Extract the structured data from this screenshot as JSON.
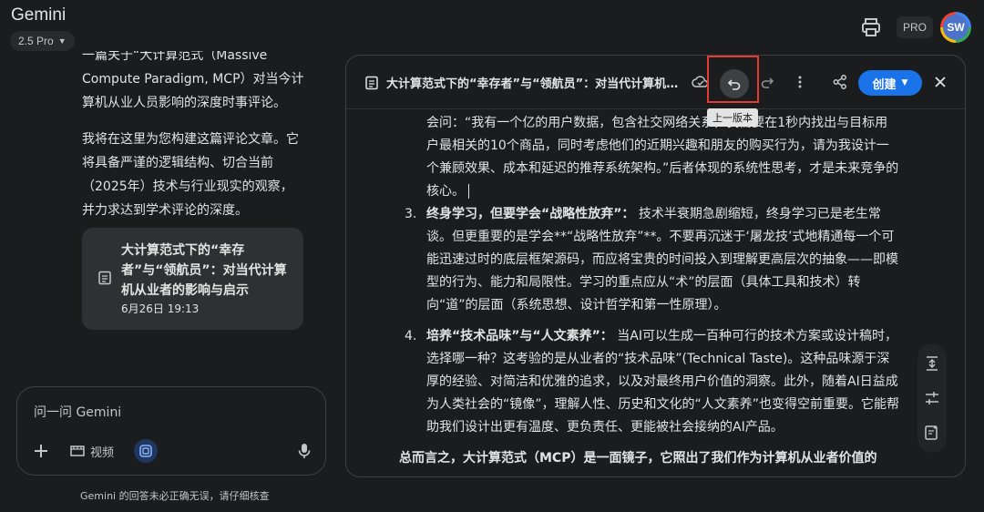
{
  "app": {
    "title": "Gemini",
    "model": "2.5 Pro",
    "pro_label": "PRO",
    "avatar_initials": "SW"
  },
  "chat": {
    "msg_top": "一篇关于“大计算范式（Massive Compute Paradigm, MCP）对当今计算机从业人员影响的深度时事评论。",
    "msg_mid": "我将在这里为您构建这篇评论文章。它将具备严谨的逻辑结构、切合当前（2025年）技术与行业现实的观察，并力求达到学术评论的深度。",
    "doc_card": {
      "title": "大计算范式下的“幸存者”与“领航员”：对当代计算机从业者的影响与启示",
      "date": "6月26日 19:13"
    }
  },
  "input": {
    "placeholder": "问一问 Gemini",
    "video_label": "视频"
  },
  "disclaimer": "Gemini 的回答未必正确无误，请仔细核查",
  "canvas": {
    "title": "大计算范式下的“幸存者”与“领航员”：对当代计算机从...",
    "undo_tooltip": "上一版本",
    "create_label": "创建",
    "body": {
      "p1": "会问：“我有一个亿的用户数据，包含社交网络关系，我需要在1秒内找出与目标用户最相关的10个商品，同时考虑他们的近期兴趣和朋友的购买行为，请为我设计一个兼顾效果、成本和延迟的推荐系统架构。”后者体现的系统性思考，才是未来竞争的核心。",
      "item3_num": "3.",
      "item3_head": "终身学习，但要学会“战略性放弃”：",
      "item3_text": "技术半衰期急剧缩短，终身学习已是老生常谈。但更重要的是学会**“战略性放弃”**。不要再沉迷于‘屠龙技’式地精通每一个可能迅速过时的底层框架源码，而应将宝贵的时间投入到理解更高层次的抽象——即模型的行为、能力和局限性。学习的重点应从“术”的层面（具体工具和技术）转向“道”的层面（系统思想、设计哲学和第一性原理）。",
      "item4_num": "4.",
      "item4_head": "培养“技术品味”与“人文素养”：",
      "item4_text": "当AI可以生成一百种可行的技术方案或设计稿时，选择哪一种？这考验的是从业者的“技术品味”(Technical Taste)。这种品味源于深厚的经验、对简洁和优雅的追求，以及对最终用户价值的洞察。此外，随着AI日益成为人类社会的“镜像”，理解人性、历史和文化的“人文素养”也变得空前重要。它能帮助我们设计出更有温度、更负责任、更能被社会接纳的AI产品。",
      "summary": "总而言之，大计算范式（MCP）是一面镜子，它照出了我们作为计算机从业者价值的"
    }
  }
}
